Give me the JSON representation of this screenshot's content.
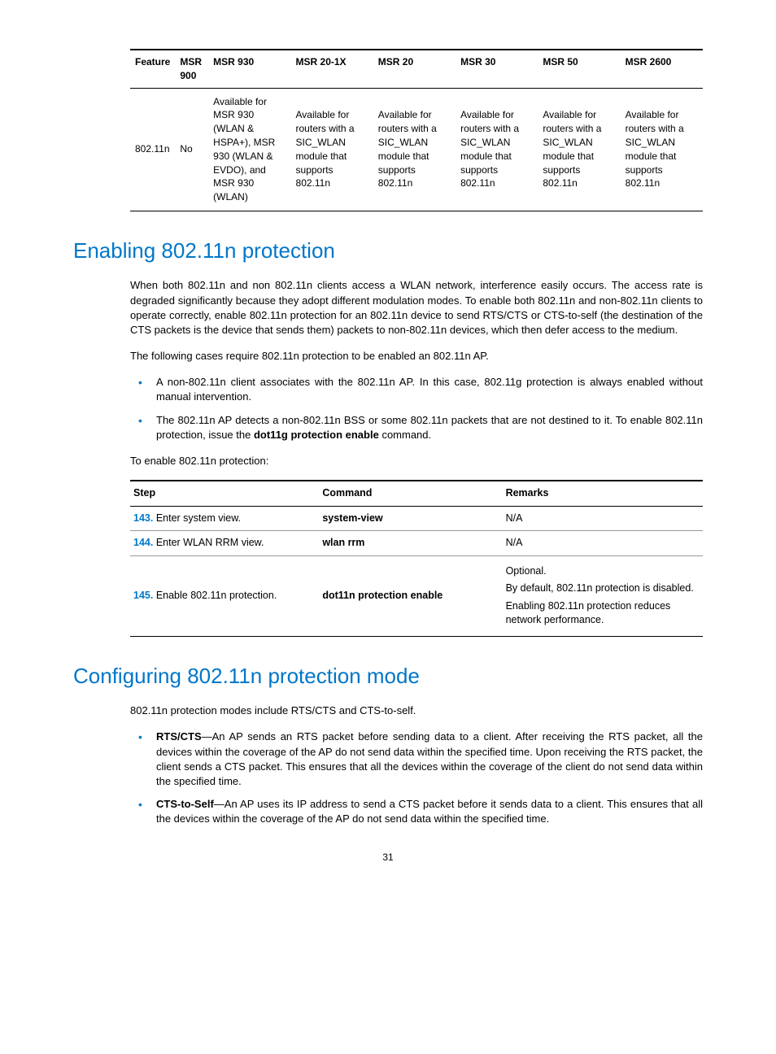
{
  "feature_table": {
    "headers": [
      "Feature",
      "MSR 900",
      "MSR 930",
      "MSR 20-1X",
      "MSR 20",
      "MSR 30",
      "MSR 50",
      "MSR 2600"
    ],
    "row": {
      "feature": "802.11n",
      "msr900": "No",
      "msr930": "Available for MSR 930 (WLAN & HSPA+), MSR 930 (WLAN & EVDO), and MSR 930 (WLAN)",
      "msr20_1x": "Available for routers with a SIC_WLAN module that supports 802.11n",
      "msr20": "Available for routers with a SIC_WLAN module that supports 802.11n",
      "msr30": "Available for routers with a SIC_WLAN module that supports 802.11n",
      "msr50": "Available for routers with a SIC_WLAN module that supports 802.11n",
      "msr2600": "Available for routers with a SIC_WLAN module that supports 802.11n"
    }
  },
  "section1": {
    "title": "Enabling 802.11n protection",
    "para1": "When both 802.11n and non 802.11n clients access a WLAN network, interference easily occurs. The access rate is degraded significantly because they adopt different modulation modes. To enable both 802.11n and non-802.11n clients to operate correctly, enable 802.11n protection for an 802.11n device to send RTS/CTS or CTS-to-self (the destination of the CTS packets is the device that sends them) packets to non-802.11n devices, which then defer access to the medium.",
    "para2": "The following cases require 802.11n protection to be enabled an 802.11n AP.",
    "bullet1": "A non-802.11n client associates with the 802.11n AP. In this case, 802.11g protection is always enabled without manual intervention.",
    "bullet2_a": "The 802.11n AP detects a non-802.11n BSS or some 802.11n packets that are not destined to it. To enable 802.11n protection, issue the ",
    "bullet2_cmd": "dot11g protection enable",
    "bullet2_b": " command.",
    "para3": "To enable 802.11n protection:",
    "step_table": {
      "headers": [
        "Step",
        "Command",
        "Remarks"
      ],
      "rows": [
        {
          "num": "143.",
          "step": " Enter system view.",
          "command": "system-view",
          "remarks": [
            "N/A"
          ]
        },
        {
          "num": "144.",
          "step": " Enter WLAN RRM view.",
          "command": "wlan rrm",
          "remarks": [
            "N/A"
          ]
        },
        {
          "num": "145.",
          "step": " Enable 802.11n protection.",
          "command": "dot11n protection enable",
          "remarks": [
            "Optional.",
            "By default, 802.11n protection is disabled.",
            "Enabling 802.11n protection reduces network performance."
          ]
        }
      ]
    }
  },
  "section2": {
    "title": "Configuring 802.11n protection mode",
    "para1": "802.11n protection modes include RTS/CTS and CTS-to-self.",
    "b1_lbl": "RTS/CTS",
    "b1_txt": "—An AP sends an RTS packet before sending data to a client. After receiving the RTS packet, all the devices within the coverage of the AP do not send data within the specified time. Upon receiving the RTS packet, the client sends a CTS packet. This ensures that all the devices within the coverage of the client do not send data within the specified time.",
    "b2_lbl": "CTS-to-Self",
    "b2_txt": "—An AP uses its IP address to send a CTS packet before it sends data to a client. This ensures that all the devices within the coverage of the AP do not send data within the specified time."
  },
  "page_number": "31"
}
